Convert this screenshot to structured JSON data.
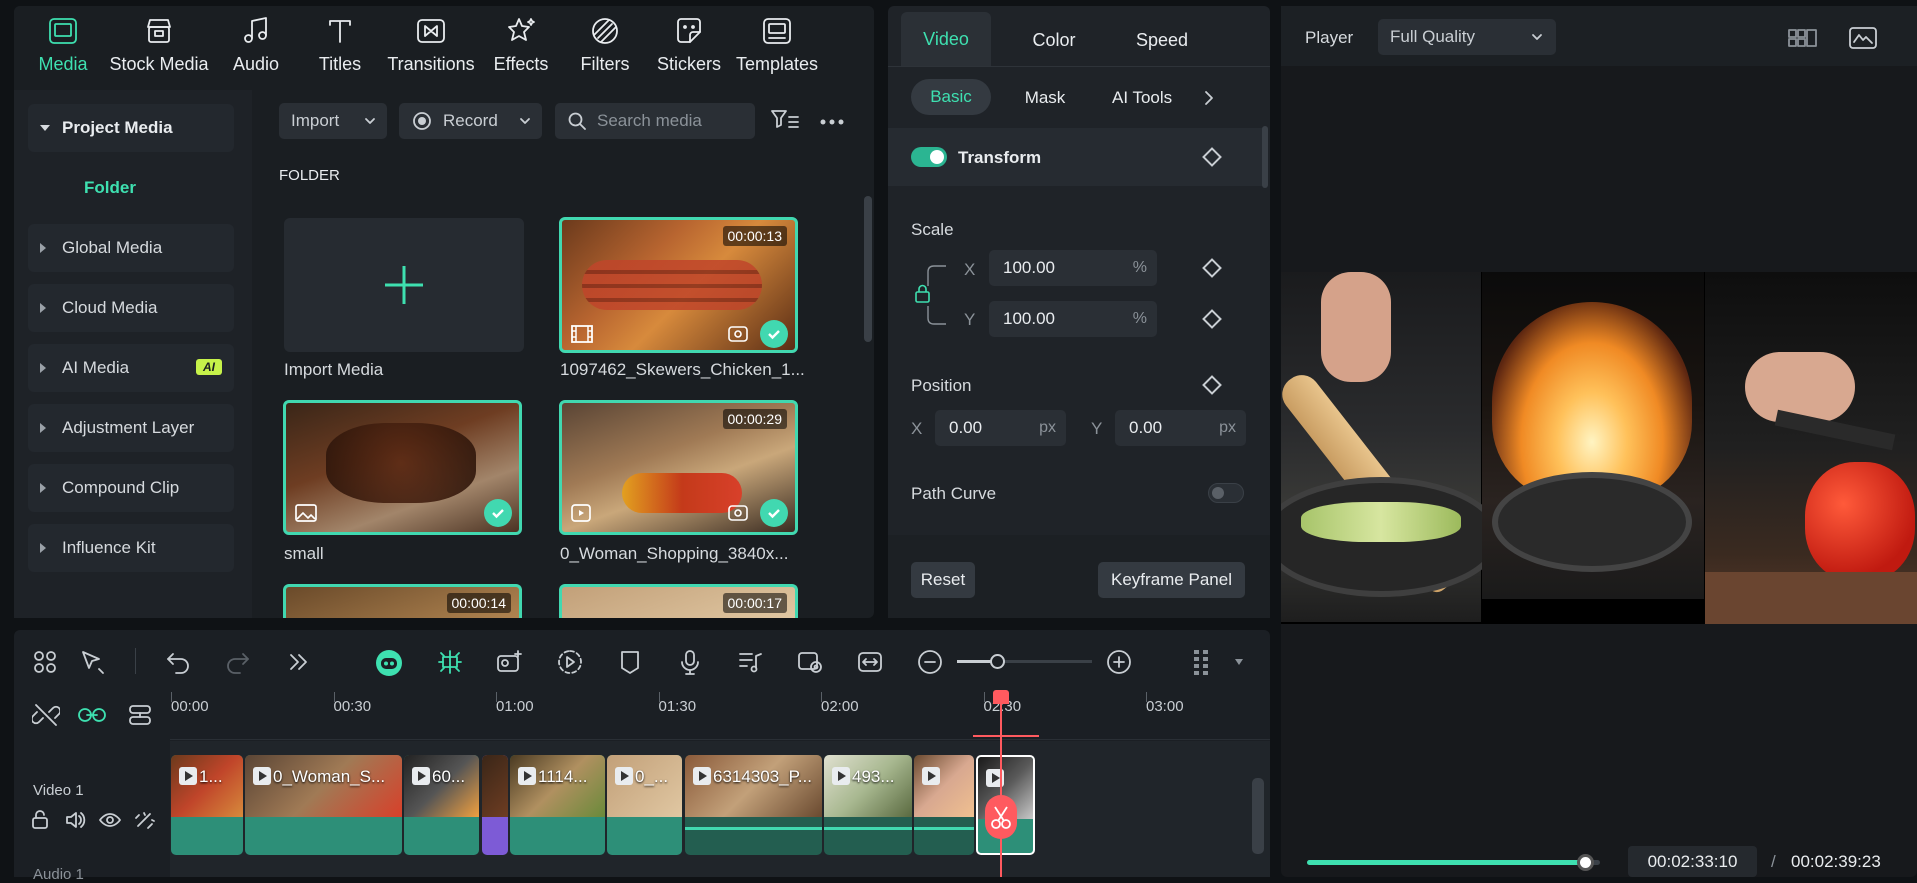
{
  "tabs": [
    {
      "label": "Media",
      "icon": "media-icon"
    },
    {
      "label": "Stock Media",
      "icon": "stock-media-icon"
    },
    {
      "label": "Audio",
      "icon": "audio-icon"
    },
    {
      "label": "Titles",
      "icon": "titles-icon"
    },
    {
      "label": "Transitions",
      "icon": "transitions-icon"
    },
    {
      "label": "Effects",
      "icon": "effects-icon"
    },
    {
      "label": "Filters",
      "icon": "filters-icon"
    },
    {
      "label": "Stickers",
      "icon": "stickers-icon"
    },
    {
      "label": "Templates",
      "icon": "templates-icon"
    }
  ],
  "sidebar": {
    "project_media": "Project Media",
    "folder": "Folder",
    "items": [
      "Global Media",
      "Cloud Media",
      "AI Media",
      "Adjustment Layer",
      "Compound Clip",
      "Influence Kit"
    ],
    "ai_badge": "AI"
  },
  "media_toolbar": {
    "import": "Import",
    "record": "Record",
    "search_placeholder": "Search media"
  },
  "folder_heading": "FOLDER",
  "media_items": [
    {
      "caption": "Import Media"
    },
    {
      "caption": "1097462_Skewers_Chicken_1...",
      "duration": "00:00:13"
    },
    {
      "caption": "small"
    },
    {
      "caption": "0_Woman_Shopping_3840x...",
      "duration": "00:00:29"
    },
    {
      "duration": "00:00:14"
    },
    {
      "duration": "00:00:17"
    }
  ],
  "props": {
    "tabs": [
      "Video",
      "Color",
      "Speed"
    ],
    "subtabs": [
      "Basic",
      "Mask",
      "AI Tools"
    ],
    "transform": "Transform",
    "scale": "Scale",
    "scale_x_label": "X",
    "scale_x": "100.00",
    "scale_y_label": "Y",
    "scale_y": "100.00",
    "percent": "%",
    "position": "Position",
    "pos_x_label": "X",
    "pos_x": "0.00",
    "pos_y_label": "Y",
    "pos_y": "0.00",
    "px": "px",
    "path_curve": "Path Curve",
    "reset": "Reset",
    "keyframe_panel": "Keyframe Panel"
  },
  "player": {
    "label": "Player",
    "quality": "Full Quality",
    "current_time": "00:02:33:10",
    "separator": "/",
    "total_time": "00:02:39:23",
    "progress": 0.95
  },
  "timeline": {
    "ticks": [
      "00:00",
      "00:30",
      "01:00",
      "01:30",
      "02:00",
      "02:30",
      "03:00"
    ],
    "track_video": "Video 1",
    "track_audio": "Audio 1",
    "clips": [
      "1...",
      "0_Woman_S...",
      "60...",
      "",
      "1114...",
      "0_...",
      "6314303_P...",
      "493...",
      "",
      ""
    ]
  },
  "colors": {
    "accent": "#3ee0b0",
    "playhead": "#ff5a5f",
    "clip": "#2d8f78",
    "purple": "#7d5bd6"
  }
}
